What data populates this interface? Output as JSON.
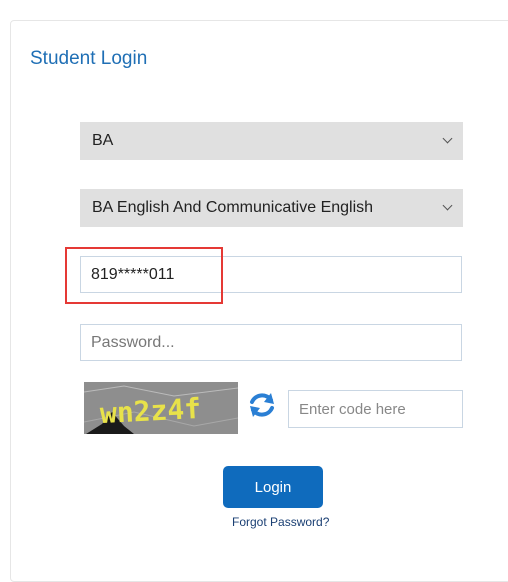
{
  "panel": {
    "title": "Student Login"
  },
  "form": {
    "course_select": "BA",
    "subject_select": "BA English And Communicative English",
    "username_value": "819*****011",
    "password_placeholder": "Password...",
    "captcha_text": "wn2z4f",
    "captcha_code_placeholder": "Enter code here",
    "login_label": "Login",
    "forgot_label": "Forgot Password?"
  },
  "colors": {
    "title": "#1f6fb5",
    "select_bg": "#e0e0e0",
    "field_border": "#c9d6e3",
    "highlight": "#e53935",
    "button_bg": "#0f6bbd"
  }
}
